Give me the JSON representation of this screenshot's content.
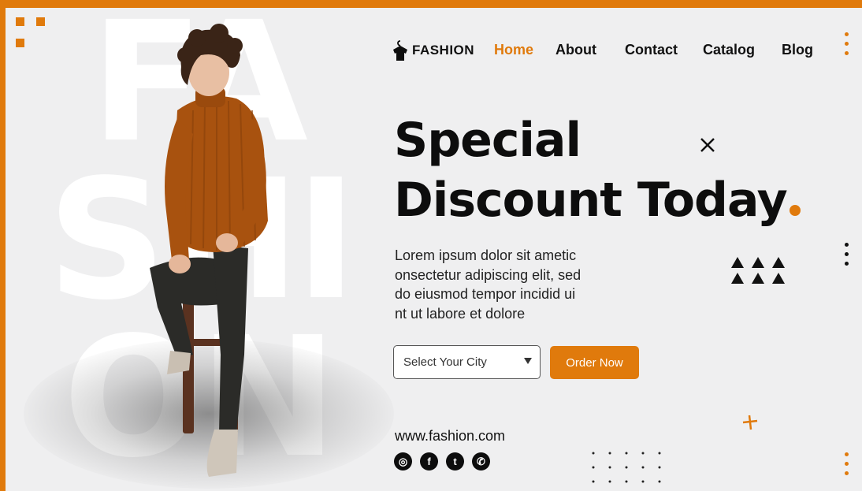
{
  "brand": {
    "name": "FASHION"
  },
  "background_text": [
    "FA",
    "SHI",
    "ON"
  ],
  "nav": {
    "items": [
      {
        "label": "Home",
        "active": true
      },
      {
        "label": "About",
        "active": false
      },
      {
        "label": "Contact",
        "active": false
      },
      {
        "label": "Catalog",
        "active": false
      },
      {
        "label": "Blog",
        "active": false
      }
    ]
  },
  "hero": {
    "headline_line1": "Special",
    "headline_line2": "Discount Today",
    "description_lines": [
      "Lorem ipsum dolor sit ametic",
      "onsectetur adipiscing elit, sed",
      "do eiusmod tempor incidid ui",
      "nt ut labore et dolore"
    ]
  },
  "form": {
    "city_select_value": "Select Your City",
    "order_button_label": "Order Now"
  },
  "footer": {
    "website": "www.fashion.com",
    "socials": [
      {
        "name": "instagram-icon",
        "glyph": "◎"
      },
      {
        "name": "facebook-icon",
        "glyph": "f"
      },
      {
        "name": "twitter-icon",
        "glyph": "t"
      },
      {
        "name": "whatsapp-icon",
        "glyph": "✆"
      }
    ]
  },
  "colors": {
    "accent": "#e07a0c",
    "background": "#efeff0",
    "text": "#0d0d0d",
    "sweater": "#a8520f",
    "pants": "#2b2b28",
    "stool": "#5a3220"
  }
}
